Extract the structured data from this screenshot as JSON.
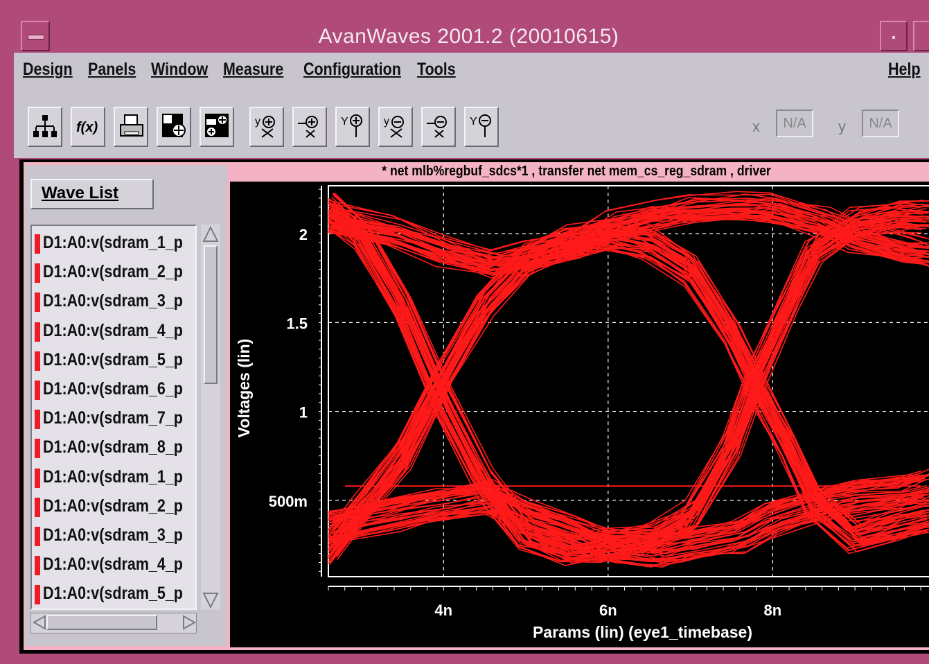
{
  "window": {
    "title": "AvanWaves 2001.2  (20010615)"
  },
  "menubar": {
    "items": [
      "Design",
      "Panels",
      "Window",
      "Measure",
      "Configuration",
      "Tools"
    ],
    "help": "Help"
  },
  "toolbar": {
    "buttons": [
      "hierarchy-icon",
      "function-icon",
      "print-icon",
      "add-panel-icon",
      "add-panel-multi-icon",
      "cursor-y-add-icon",
      "cursor-x-add-icon",
      "cursor-y-point-add-icon",
      "cursor-y-remove-icon",
      "cursor-x-remove-icon",
      "cursor-y-point-remove-icon"
    ],
    "x_label": "x",
    "x_value": "N/A",
    "y_label": "y",
    "y_value": "N/A"
  },
  "wave_panel": {
    "button": "Wave List",
    "items": [
      "D1:A0:v(sdram_1_p",
      "D1:A0:v(sdram_2_p",
      "D1:A0:v(sdram_3_p",
      "D1:A0:v(sdram_4_p",
      "D1:A0:v(sdram_5_p",
      "D1:A0:v(sdram_6_p",
      "D1:A0:v(sdram_7_p",
      "D1:A0:v(sdram_8_p",
      "D1:A0:v(sdram_1_p",
      "D1:A0:v(sdram_2_p",
      "D1:A0:v(sdram_3_p",
      "D1:A0:v(sdram_4_p",
      "D1:A0:v(sdram_5_p"
    ],
    "marker_color": "#ee1b26"
  },
  "plot": {
    "title": "* net mlb%regbuf_sdcs*1 , transfer net mem_cs_reg_sdram , driver",
    "trace_color": "#ff1a1a"
  },
  "chart_data": {
    "type": "line",
    "title": "* net mlb%regbuf_sdcs*1 , transfer net mem_cs_reg_sdram , driver",
    "xlabel": "Params (lin) (eye1_timebase)",
    "ylabel": "Voltages (lin)",
    "xlim": [
      2.6,
      9.9
    ],
    "ylim": [
      0.07,
      2.27
    ],
    "x_ticks": [
      4,
      6,
      8
    ],
    "x_tick_labels": [
      "4n",
      "6n",
      "8n"
    ],
    "y_ticks": [
      0.5,
      1,
      1.5,
      2
    ],
    "y_tick_labels": [
      "500m",
      "1",
      "1.5",
      "2"
    ],
    "grid": true,
    "series": [
      {
        "x": [
          2.6,
          3.4,
          4.0,
          4.6,
          5.0,
          5.6,
          6.0,
          6.6,
          7.0,
          7.6,
          8.0,
          8.6,
          9.0,
          9.6,
          9.9
        ],
        "values": [
          2.1,
          2.02,
          1.92,
          1.85,
          1.88,
          1.95,
          2.05,
          2.12,
          2.15,
          2.16,
          2.15,
          2.08,
          2.0,
          1.93,
          1.9
        ]
      },
      {
        "x": [
          2.6,
          3.0,
          3.5,
          4.0,
          4.5,
          5.0,
          5.5,
          6.0,
          6.5,
          7.0,
          7.5,
          7.8,
          8.2,
          8.5,
          9.0,
          9.5,
          9.9
        ],
        "values": [
          2.15,
          2.0,
          1.6,
          1.05,
          0.6,
          0.3,
          0.22,
          0.24,
          0.28,
          0.4,
          0.8,
          1.2,
          1.6,
          1.9,
          2.05,
          2.1,
          2.1
        ]
      },
      {
        "x": [
          2.6,
          3.0,
          3.5,
          4.0,
          4.5,
          5.0,
          5.5,
          6.0,
          6.5,
          7.0,
          7.5,
          7.8,
          8.2,
          8.5,
          9.0,
          9.5,
          9.9
        ],
        "values": [
          0.22,
          0.45,
          0.75,
          1.2,
          1.6,
          1.85,
          1.95,
          2.0,
          1.95,
          1.8,
          1.45,
          1.15,
          0.8,
          0.5,
          0.3,
          0.35,
          0.4
        ]
      },
      {
        "x": [
          2.6,
          3.4,
          4.0,
          4.6,
          5.0,
          5.6,
          6.0,
          6.6,
          7.0,
          7.6,
          8.0,
          8.6,
          9.0,
          9.6,
          9.9
        ],
        "values": [
          0.35,
          0.42,
          0.48,
          0.52,
          0.42,
          0.32,
          0.25,
          0.22,
          0.25,
          0.3,
          0.4,
          0.48,
          0.52,
          0.55,
          0.58
        ]
      },
      {
        "x": [
          2.8,
          9.8
        ],
        "values": [
          0.58,
          0.58
        ]
      }
    ]
  }
}
